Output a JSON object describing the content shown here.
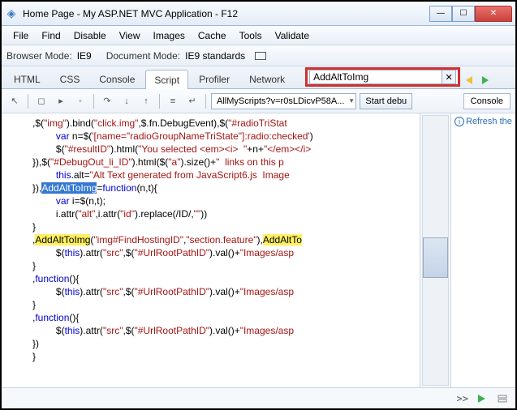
{
  "title": "Home Page - My ASP.NET MVC Application - F12",
  "menu": [
    "File",
    "Find",
    "Disable",
    "View",
    "Images",
    "Cache",
    "Tools",
    "Validate"
  ],
  "modes": {
    "browserLbl": "Browser Mode:",
    "browserVal": "IE9",
    "docLbl": "Document Mode:",
    "docVal": "IE9 standards"
  },
  "tabs": [
    "HTML",
    "CSS",
    "Console",
    "Script",
    "Profiler",
    "Network"
  ],
  "activeTab": "Script",
  "search": {
    "value": "AddAltToImg",
    "clear": "✕"
  },
  "scriptDropdown": "AllMyScripts?v=r0sLDicvP58A...",
  "debugBtn": "Start debu",
  "rightTab": "Console",
  "info": "Refresh the",
  "prompt": ">>",
  "code": {
    "l1a": ",$(",
    "l1b": "\"img\"",
    "l1c": ").bind(",
    "l1d": "\"click.img\"",
    "l1e": ",$.fn.DebugEvent),$(",
    "l1f": "\"#radioTriStat",
    "l2a": "var",
    "l2b": " n=$(",
    "l2c": "'[name=\"radioGroupNameTriState\"]:radio:checked'",
    "l2d": ")",
    "l3a": "$(",
    "l3b": "\"#resultID\"",
    "l3c": ").html(",
    "l3d": "\"You selected <em><i>  \"",
    "l3e": "+n+",
    "l3f": "\"</em></i>",
    "l4a": "}),$(",
    "l4b": "\"#DebugOut_li_ID\"",
    "l4c": ").html($(",
    "l4d": "\"a\"",
    "l4e": ").size()+",
    "l4f": "\"  links on this p",
    "l5a": "this",
    "l5b": ".alt=",
    "l5c": "\"Alt Text generated from JavaScript6.js  Image ",
    "l6a": "}),",
    "l6b": "AddAltToImg",
    "l6c": "=",
    "l6d": "function",
    "l6e": "(n,t){",
    "l7a": "var",
    "l7b": " i=$(n,t);",
    "l8a": "i.attr(",
    "l8b": "\"alt\"",
    "l8c": ",i.attr(",
    "l8d": "\"id\"",
    "l8e": ").replace(/ID/,",
    "l8f": "\"\"",
    "l8g": "))",
    "l9": "}",
    "l10a": ",",
    "l10b": "AddAltToImg",
    "l10c": "(",
    "l10d": "\"img#FindHostingID\"",
    "l10e": ",",
    "l10f": "\"section.feature\"",
    "l10g": "),",
    "l10h": "AddAltTo",
    "l11a": "$(",
    "l11b": "this",
    "l11c": ").attr(",
    "l11d": "\"src\"",
    "l11e": ",$(",
    "l11f": "\"#UrlRootPathID\"",
    "l11g": ").val()+",
    "l11h": "\"Images/asp",
    "l12": "}",
    "l13a": ",",
    "l13b": "function",
    "l13c": "(){",
    "l14a": "$(",
    "l14b": "this",
    "l14c": ").attr(",
    "l14d": "\"src\"",
    "l14e": ",$(",
    "l14f": "\"#UrlRootPathID\"",
    "l14g": ").val()+",
    "l14h": "\"Images/asp",
    "l15": "}",
    "l16a": ",",
    "l16b": "function",
    "l16c": "(){",
    "l17a": "$(",
    "l17b": "this",
    "l17c": ").attr(",
    "l17d": "\"src\"",
    "l17e": ",$(",
    "l17f": "\"#UrlRootPathID\"",
    "l17g": ").val()+",
    "l17h": "\"Images/asp",
    "l18": "})",
    "l19": "}"
  }
}
